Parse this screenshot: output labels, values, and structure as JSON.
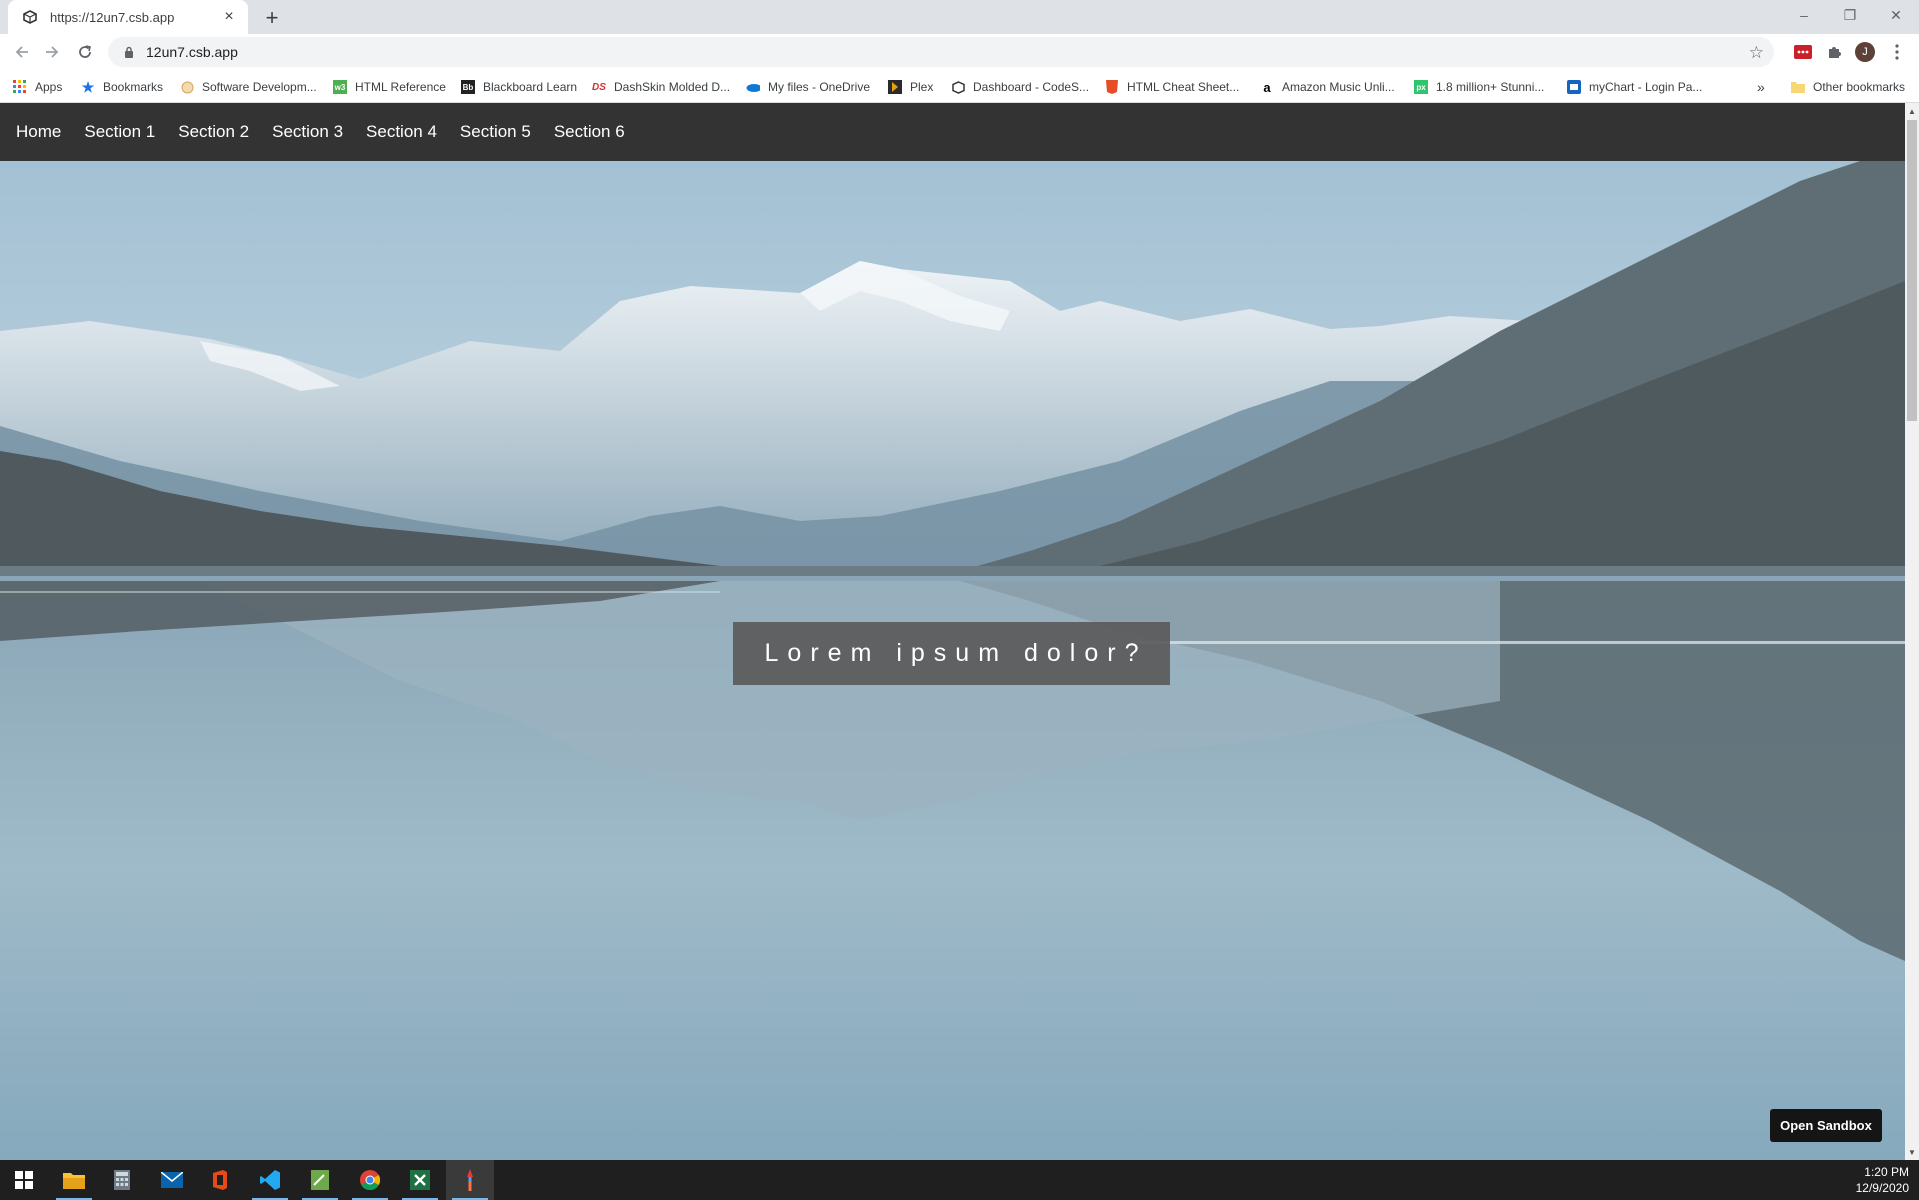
{
  "browser": {
    "tab_title": "https://12un7.csb.app",
    "tab_close": "×",
    "new_tab": "+",
    "url": "12un7.csb.app",
    "window_controls": {
      "minimize": "–",
      "restore": "❐",
      "close": "✕"
    },
    "avatar_letter": "J",
    "bookmarks_overflow": "»"
  },
  "bookmarks": [
    {
      "label": "Apps",
      "icon": "apps-grid-icon",
      "color": "#4285f4"
    },
    {
      "label": "Bookmarks",
      "icon": "star-icon",
      "color": "#1a73e8"
    },
    {
      "label": "Software Developm...",
      "icon": "globe-icon",
      "color": "#e2a857"
    },
    {
      "label": "HTML Reference",
      "icon": "w3-icon",
      "color": "#4caf50"
    },
    {
      "label": "Blackboard Learn",
      "icon": "blackboard-icon",
      "color": "#222222"
    },
    {
      "label": "DashSkin Molded D...",
      "icon": "dashskin-icon",
      "color": "#d32f2f"
    },
    {
      "label": "My files - OneDrive",
      "icon": "onedrive-icon",
      "color": "#0f78d4"
    },
    {
      "label": "Plex",
      "icon": "plex-icon",
      "color": "#e5a00d"
    },
    {
      "label": "Dashboard - CodeS...",
      "icon": "codesandbox-icon",
      "color": "#333333"
    },
    {
      "label": "HTML Cheat Sheet...",
      "icon": "html5-icon",
      "color": "#e44d26"
    },
    {
      "label": "Amazon Music Unli...",
      "icon": "amazon-icon",
      "color": "#000000"
    },
    {
      "label": "1.8 million+ Stunni...",
      "icon": "pixabay-icon",
      "color": "#2ec66d"
    },
    {
      "label": "myChart - Login Pa...",
      "icon": "mychart-icon",
      "color": "#1565c0"
    }
  ],
  "other_bookmarks": "Other bookmarks",
  "site": {
    "nav": [
      "Home",
      "Section 1",
      "Section 2",
      "Section 3",
      "Section 4",
      "Section 5",
      "Section 6"
    ],
    "headline": "Lorem ipsum dolor?",
    "open_sandbox": "Open Sandbox"
  },
  "taskbar": {
    "apps": [
      "windows-start-icon",
      "file-explorer-icon",
      "calculator-icon",
      "mail-icon",
      "office-icon",
      "vscode-icon",
      "notepad-icon",
      "chrome-icon",
      "excel-icon",
      "paint-icon"
    ],
    "time": "1:20 PM",
    "date": "12/9/2020"
  },
  "colors": {
    "site_nav_bg": "#333333",
    "headline_bg": "#5a5a5a",
    "sky": "#a9c6d8"
  }
}
